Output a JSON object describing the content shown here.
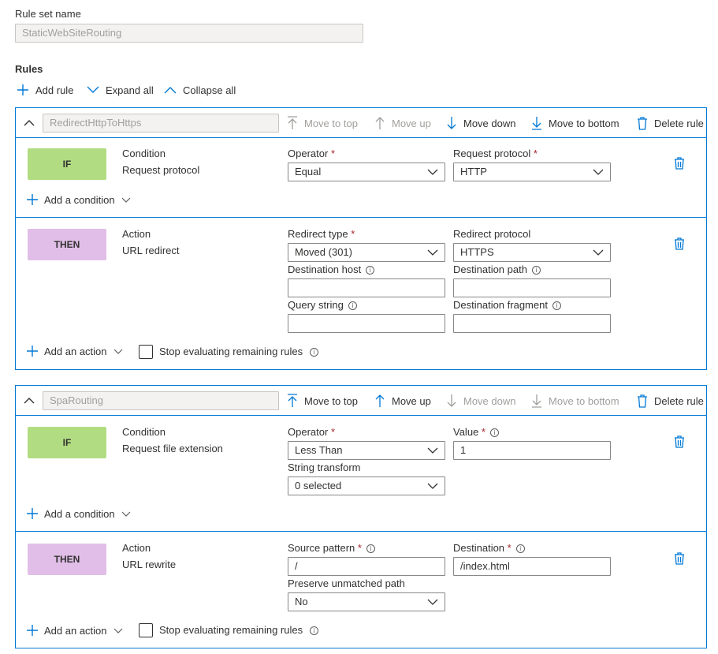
{
  "rule_set_name_label": "Rule set name",
  "rule_set_name_value": "StaticWebSiteRouting",
  "rules_heading": "Rules",
  "toolbar": {
    "add_rule": "Add rule",
    "expand_all": "Expand all",
    "collapse_all": "Collapse all"
  },
  "rule_actions": {
    "move_to_top": "Move to top",
    "move_up": "Move up",
    "move_down": "Move down",
    "move_to_bottom": "Move to bottom",
    "delete_rule": "Delete rule"
  },
  "common": {
    "if_badge": "IF",
    "then_badge": "THEN",
    "condition_label": "Condition",
    "action_label": "Action",
    "add_condition": "Add a condition",
    "add_action": "Add an action",
    "stop_evaluating": "Stop evaluating remaining rules",
    "required_marker": "*",
    "info_glyph": "i"
  },
  "rule1": {
    "name": "RedirectHttpToHttps",
    "disabled_actions": [
      "Move to top",
      "Move up"
    ],
    "condition": {
      "type": "Request protocol",
      "operator_label": "Operator",
      "operator_value": "Equal",
      "value_label": "Request protocol",
      "value_value": "HTTP"
    },
    "action": {
      "type": "URL redirect",
      "redirect_type_label": "Redirect type",
      "redirect_type_value": "Moved (301)",
      "redirect_protocol_label": "Redirect protocol",
      "redirect_protocol_value": "HTTPS",
      "destination_host_label": "Destination host",
      "destination_host_value": "",
      "destination_path_label": "Destination path",
      "destination_path_value": "",
      "query_string_label": "Query string",
      "query_string_value": "",
      "destination_fragment_label": "Destination fragment",
      "destination_fragment_value": "",
      "stop_evaluating_checked": false
    }
  },
  "rule2": {
    "name": "SpaRouting",
    "disabled_actions": [
      "Move down",
      "Move to bottom"
    ],
    "condition": {
      "type": "Request file extension",
      "operator_label": "Operator",
      "operator_value": "Less Than",
      "value_label": "Value",
      "value_value": "1",
      "string_transform_label": "String transform",
      "string_transform_value": "0 selected"
    },
    "action": {
      "type": "URL rewrite",
      "source_pattern_label": "Source pattern",
      "source_pattern_value": "/",
      "destination_label": "Destination",
      "destination_value": "/index.html",
      "preserve_label": "Preserve unmatched path",
      "preserve_value": "No",
      "stop_evaluating_checked": false
    }
  },
  "colors": {
    "accent": "#0078d4",
    "if_badge": "#b2dc82",
    "then_badge": "#e1bee7",
    "required": "#a4262c",
    "disabled_text": "#a19f9d"
  }
}
